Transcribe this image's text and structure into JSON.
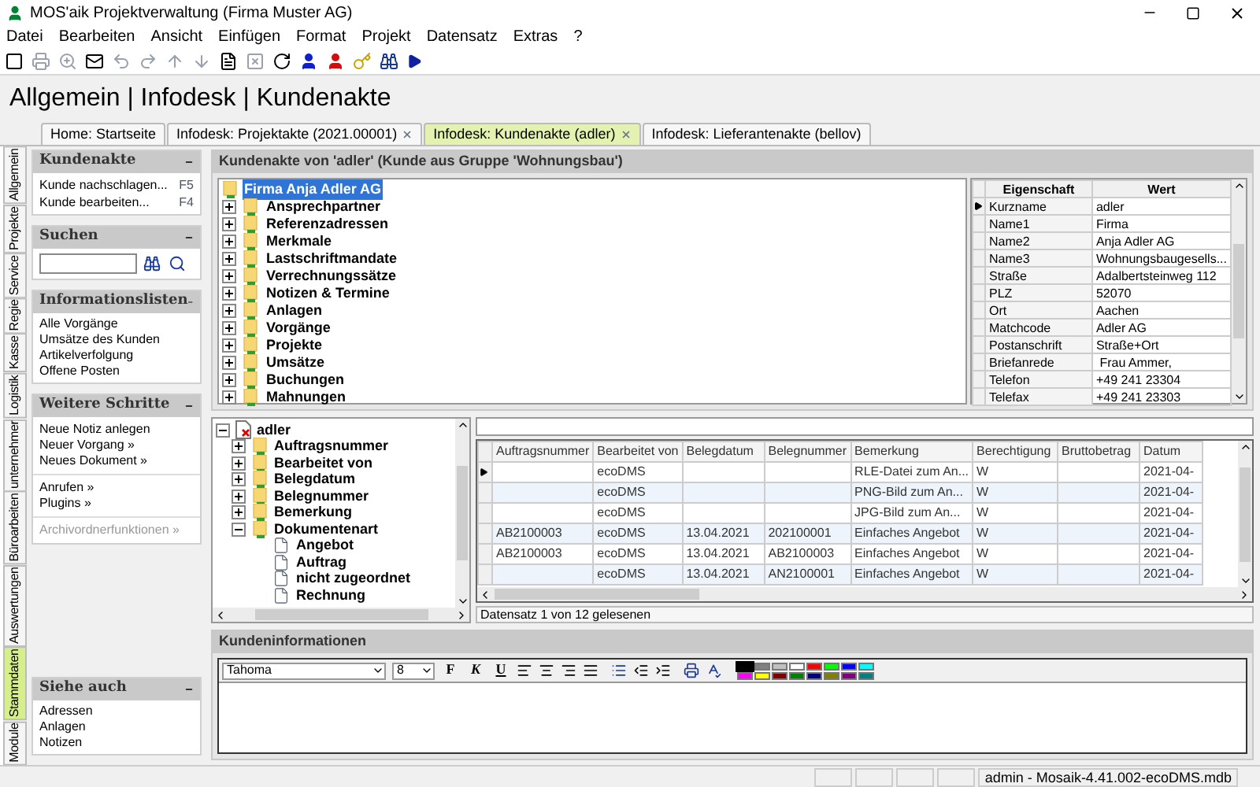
{
  "window": {
    "title": "MOS'aik Projektverwaltung (Firma Muster AG)"
  },
  "menu": [
    "Datei",
    "Bearbeiten",
    "Ansicht",
    "Einfügen",
    "Format",
    "Projekt",
    "Datensatz",
    "Extras",
    "?"
  ],
  "breadcrumb": "Allgemein | Infodesk | Kundenakte",
  "tabs": [
    {
      "label": "Home: Startseite",
      "selected": false,
      "closable": false
    },
    {
      "label": "Infodesk: Projektakte (2021.00001)",
      "selected": false,
      "closable": true
    },
    {
      "label": "Infodesk: Kundenakte (adler)",
      "selected": true,
      "closable": true
    },
    {
      "label": "Infodesk: Lieferantenakte (bellov)",
      "selected": false,
      "closable": false
    }
  ],
  "side_tabs": [
    {
      "label": "Allgemein",
      "selected": false
    },
    {
      "label": "Projekte",
      "selected": false
    },
    {
      "label": "Service",
      "selected": false
    },
    {
      "label": "Regie",
      "selected": false
    },
    {
      "label": "Kasse",
      "selected": false
    },
    {
      "label": "Logistik",
      "selected": false
    },
    {
      "label": "unternehmer",
      "selected": false
    },
    {
      "label": "Büroarbeiten",
      "selected": false
    },
    {
      "label": "Auswertungen",
      "selected": false
    },
    {
      "label": "Stammdaten",
      "selected": true
    },
    {
      "label": "Module",
      "selected": false
    }
  ],
  "left_panel": {
    "kundenakte": {
      "title": "Kundenakte",
      "items": [
        {
          "label": "Kunde nachschlagen...",
          "shortcut": "F5"
        },
        {
          "label": "Kunde bearbeiten...",
          "shortcut": "F4"
        }
      ]
    },
    "search": {
      "title": "Suchen"
    },
    "info_lists": {
      "title": "Informationslisten",
      "items": [
        "Alle Vorgänge",
        "Umsätze des Kunden",
        "Artikelverfolgung",
        "Offene Posten"
      ]
    },
    "next_steps": {
      "title": "Weitere Schritte",
      "groups": [
        {
          "items": [
            {
              "label": "Neue Notiz anlegen",
              "disabled": false
            },
            {
              "label": "Neuer Vorgang »",
              "disabled": false
            },
            {
              "label": "Neues Dokument »",
              "disabled": false
            }
          ]
        },
        {
          "items": [
            {
              "label": "Anrufen »",
              "disabled": false
            },
            {
              "label": "Plugins »",
              "disabled": false
            }
          ]
        },
        {
          "items": [
            {
              "label": "Archivordnerfunktionen »",
              "disabled": true
            }
          ]
        }
      ]
    },
    "see_also": {
      "title": "Siehe auch",
      "items": [
        "Adressen",
        "Anlagen",
        "Notizen"
      ]
    }
  },
  "record_panel": {
    "title": "Kundenakte von 'adler' (Kunde aus Gruppe 'Wohnungsbau')",
    "tree": {
      "label": "Firma Anja Adler AG",
      "selected": true,
      "children": [
        {
          "label": "Ansprechpartner",
          "expanded": false
        },
        {
          "label": "Referenzadressen",
          "expanded": false
        },
        {
          "label": "Merkmale",
          "expanded": false
        },
        {
          "label": "Lastschriftmandate",
          "expanded": false
        },
        {
          "label": "Verrechnungssätze",
          "expanded": false
        },
        {
          "label": "Notizen & Termine",
          "expanded": false
        },
        {
          "label": "Anlagen",
          "expanded": false
        },
        {
          "label": "Vorgänge",
          "expanded": false
        },
        {
          "label": "Projekte",
          "expanded": false
        },
        {
          "label": "Umsätze",
          "expanded": false
        },
        {
          "label": "Buchungen",
          "expanded": false
        },
        {
          "label": "Mahnungen",
          "expanded": false
        }
      ]
    },
    "properties": {
      "columns": [
        "Eigenschaft",
        "Wert"
      ],
      "rows": [
        {
          "name": "Kurzname",
          "value": "adler",
          "selected": true
        },
        {
          "name": "Name1",
          "value": "Firma",
          "selected": false
        },
        {
          "name": "Name2",
          "value": "Anja Adler AG",
          "selected": false
        },
        {
          "name": "Name3",
          "value": "Wohnungsbaugesells...",
          "selected": false
        },
        {
          "name": "Straße",
          "value": "Adalbertsteinweg 112",
          "selected": false
        },
        {
          "name": "PLZ",
          "value": "52070",
          "selected": false
        },
        {
          "name": "Ort",
          "value": "Aachen",
          "selected": false
        },
        {
          "name": "Matchcode",
          "value": "Adler AG",
          "selected": false
        },
        {
          "name": "Postanschrift",
          "value": "Straße+Ort",
          "selected": false
        },
        {
          "name": "Briefanrede",
          "value": " Frau Ammer,",
          "selected": false
        },
        {
          "name": "Telefon",
          "value": "+49 241 23304",
          "selected": false
        },
        {
          "name": "Telefax",
          "value": "+49 241 23303",
          "selected": false
        }
      ]
    }
  },
  "documents": {
    "tree": {
      "label": "adler",
      "kind": "record",
      "expanded": true,
      "children": [
        {
          "label": "Auftragsnummer",
          "kind": "folder",
          "expanded": false
        },
        {
          "label": "Bearbeitet von",
          "kind": "folder",
          "expanded": false
        },
        {
          "label": "Belegdatum",
          "kind": "folder",
          "expanded": false
        },
        {
          "label": "Belegnummer",
          "kind": "folder",
          "expanded": false
        },
        {
          "label": "Bemerkung",
          "kind": "folder",
          "expanded": false
        },
        {
          "label": "Dokumentenart",
          "kind": "folder",
          "expanded": true,
          "children": [
            {
              "label": "Angebot",
              "kind": "file"
            },
            {
              "label": "Auftrag",
              "kind": "file"
            },
            {
              "label": "nicht zugeordnet",
              "kind": "file"
            },
            {
              "label": "Rechnung",
              "kind": "file"
            }
          ]
        }
      ]
    },
    "table": {
      "columns": [
        "Auftragsnummer",
        "Bearbeitet von",
        "Belegdatum",
        "Belegnummer",
        "Bemerkung",
        "Berechtigung",
        "Bruttobetrag",
        "Datum"
      ],
      "rows": [
        {
          "selected": true,
          "cells": [
            "",
            "ecoDMS",
            "",
            "",
            "RLE-Datei zum An...",
            "W",
            "",
            "2021-04-"
          ]
        },
        {
          "selected": false,
          "cells": [
            "",
            "ecoDMS",
            "",
            "",
            "PNG-Bild zum An...",
            "W",
            "",
            "2021-04-"
          ]
        },
        {
          "selected": false,
          "cells": [
            "",
            "ecoDMS",
            "",
            "",
            "JPG-Bild zum An...",
            "W",
            "",
            "2021-04-"
          ]
        },
        {
          "selected": false,
          "cells": [
            "AB2100003",
            "ecoDMS",
            "13.04.2021",
            "202100001",
            "Einfaches Angebot",
            "W",
            "",
            "2021-04-"
          ]
        },
        {
          "selected": false,
          "cells": [
            "AB2100003",
            "ecoDMS",
            "13.04.2021",
            "AB2100003",
            "Einfaches Angebot",
            "W",
            "",
            "2021-04-"
          ]
        },
        {
          "selected": false,
          "cells": [
            "",
            "ecoDMS",
            "13.04.2021",
            "AN2100001",
            "Einfaches Angebot",
            "W",
            "",
            "2021-04-"
          ]
        }
      ]
    },
    "status": "Datensatz 1 von 12 gelesenen"
  },
  "customer_info": {
    "title": "Kundeninformationen",
    "font": "Tahoma",
    "size": "8",
    "format_buttons": [
      "F",
      "K",
      "U"
    ],
    "colors": [
      {
        "color": "#000000",
        "selected": true
      },
      {
        "color": "#808080",
        "selected": false
      },
      {
        "color": "#c0c0c0",
        "selected": false
      },
      {
        "color": "#ffffff",
        "selected": false
      },
      {
        "color": "#ff0000",
        "selected": false
      },
      {
        "color": "#00ff00",
        "selected": false
      },
      {
        "color": "#0000ff",
        "selected": false
      },
      {
        "color": "#00ffff",
        "selected": false
      },
      {
        "color": "#ff00ff",
        "selected": false
      },
      {
        "color": "#ffff00",
        "selected": false
      },
      {
        "color": "#800000",
        "selected": false
      },
      {
        "color": "#008000",
        "selected": false
      },
      {
        "color": "#000080",
        "selected": false
      },
      {
        "color": "#808000",
        "selected": false
      },
      {
        "color": "#800080",
        "selected": false
      },
      {
        "color": "#008080",
        "selected": false
      }
    ]
  },
  "status_bar": "admin - Mosaik-4.41.002-ecoDMS.mdb"
}
